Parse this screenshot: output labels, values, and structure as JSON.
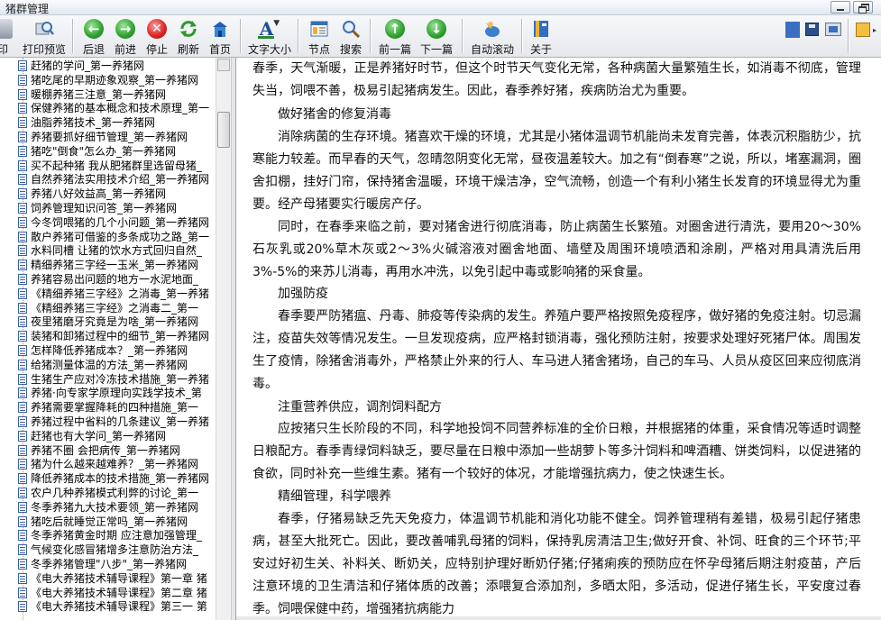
{
  "window": {
    "title": "猪群管理"
  },
  "toolbar": {
    "print": "印",
    "print_preview": "打印预览",
    "back": "后退",
    "forward": "前进",
    "stop": "停止",
    "refresh": "刷新",
    "home": "首页",
    "font_size": "文字大小",
    "font_glyph": "A",
    "nodes": "节点",
    "search": "搜索",
    "prev_article": "前一篇",
    "next_article": "下一篇",
    "auto_scroll": "自动滚动",
    "about": "关于"
  },
  "tree": {
    "items": [
      "赶猪的学问_第一养猪网",
      "猪吃尾的早期迹象观察_第一养猪网",
      "暖棚养猪三注意_第一养猪网",
      "保健养猪的基本概念和技术原理_第一",
      "油脂养猪技术_第一养猪网",
      "养猪要抓好细节管理_第一养猪网",
      "猪吃\"倒食\"怎么办_第一养猪网",
      "买不起种猪 我从肥猪群里选留母猪_",
      "自然养猪法实用技术介绍_第一养猪网",
      "养猪八好效益高_第一养猪网",
      "饲养管理知识问答_第一养猪网",
      "今冬饲喂猪的几个小问题_第一养猪网",
      "散户养猪可借鉴的多条成功之路_第一",
      "水料同槽 让猪的饮水方式回归自然_",
      "精细养猪三字经一玉米_第一养猪网",
      "养猪容易出问题的地方一水泥地面_",
      "《精细养猪三字经》之消毒_第一养猪",
      "《精细养猪三字经》之消毒二_第一",
      "夜里猪磨牙究竟是为啥_第一养猪网",
      "装猪和卸猪过程中的细节_第一养猪网",
      "怎样降低养猪成本？_第一养猪网",
      "给猪测量体温的方法_第一养猪网",
      "生猪生产应对冷冻技术措施_第一养猪",
      "养猪·向专家学原理向实践学技术_第",
      "养猪需要掌握降耗的四种措施_第一",
      "养猪过程中省料的几条建议_第一养猪",
      "赶猪也有大学问_第一养猪网",
      "养猪不圈 会把病传_第一养猪网",
      "猪为什么越来越难养？_第一养猪网",
      "降低养猪成本的技术措施_第一养猪网",
      "农户几种养猪模式利弊的讨论_第一",
      "冬季养猪九大技术要领_第一养猪网",
      "猪吃后就睡觉正常吗_第一养猪网",
      "冬季养猪黄金时期 应注意加强管理_",
      "气候变化感冒猪增多注意防治方法_",
      "冬季养猪管理\"八步\"_第一养猪网",
      "《电大养猪技术辅导课程》第一章 猪",
      "《电大养猪技术辅导课程》第二章 猪",
      "《电大养猪技术辅导课程》第三一 第"
    ]
  },
  "article": {
    "p1": "春季，天气渐暖，正是养猪好时节，但这个时节天气变化无常，各种病菌大量繁殖生长，如消毒不彻底，管理失当，饲喂不善，极易引起猪病发生。因此，春季养好猪，疾病防治尤为重要。",
    "h1": "做好猪舍的修复消毒",
    "p2": "消除病菌的生存环境。猪喜欢干燥的环境，尤其是小猪体温调节机能尚未发育完善，体表沉积脂肪少，抗寒能力较差。而早春的天气，忽晴忽阴变化无常，昼夜温差较大。加之有“倒春寒”之说，所以，堵塞漏洞，圈舍扣棚，挂好门帘，保持猪舍温暖，环境干燥洁净，空气流畅，创造一个有利小猪生长发育的环境显得尤为重要。经产母猪要实行暖房产仔。",
    "p3": "同时，在春季来临之前，要对猪舍进行彻底消毒，防止病菌生长繁殖。对圈舍进行清洗，要用20～30%石灰乳或20%草木灰或2～3%火碱溶液对圈舍地面、墙壁及周围环境喷洒和涂刷，严格对用具清洗后用3%-5%的来苏儿消毒，再用水冲洗，以免引起中毒或影响猪的采食量。",
    "h2": "加强防疫",
    "p4": "春季要严防猪瘟、丹毒、肺疫等传染病的发生。养殖户要严格按照免疫程序，做好猪的免疫注射。切忌漏注，疫苗失效等情况发生。一旦发现疫病，应严格封锁消毒，强化预防注射，按要求处理好死猪尸体。周围发生了疫情，除猪舍消毒外，严格禁止外来的行人、车马进人猪舍猪场，自己的车马、人员从疫区回来应彻底消毒。",
    "h3": "注重营养供应，调剂饲料配方",
    "p5": "应按猪只生长阶段的不同，科学地投饲不同营养标准的全价日粮，并根据猪的体重，采食情况等适时调整日粮配方。春季青绿饲料缺乏，要尽量在日粮中添加一些胡萝卜等多汁饲料和啤酒糟、饼类饲料，以促进猪的食欲，同时补充一些维生素。猪有一个较好的体况，才能增强抗病力，使之快速生长。",
    "h4": "精细管理，科学喂养",
    "p6": "春季，仔猪易缺乏先天免疫力，体温调节机能和消化功能不健全。饲养管理稍有差错，极易引起仔猪患病，甚至大批死亡。因此，要改善哺乳母猪的饲料，保持乳房清洁卫生;做好开食、补饲、旺食的三个环节;平安过好初生关、补料关、断奶关，应特别护理好断奶仔猪;仔猪痢疾的预防应在怀孕母猪后期注射疫苗，产后注意环境的卫生清洁和仔猪体质的改善；添喂复合添加剂，多晒太阳，多活动，促进仔猪生长，平安度过春季。",
    "h5": "饲喂保健中药，增强猪抗病能力"
  }
}
